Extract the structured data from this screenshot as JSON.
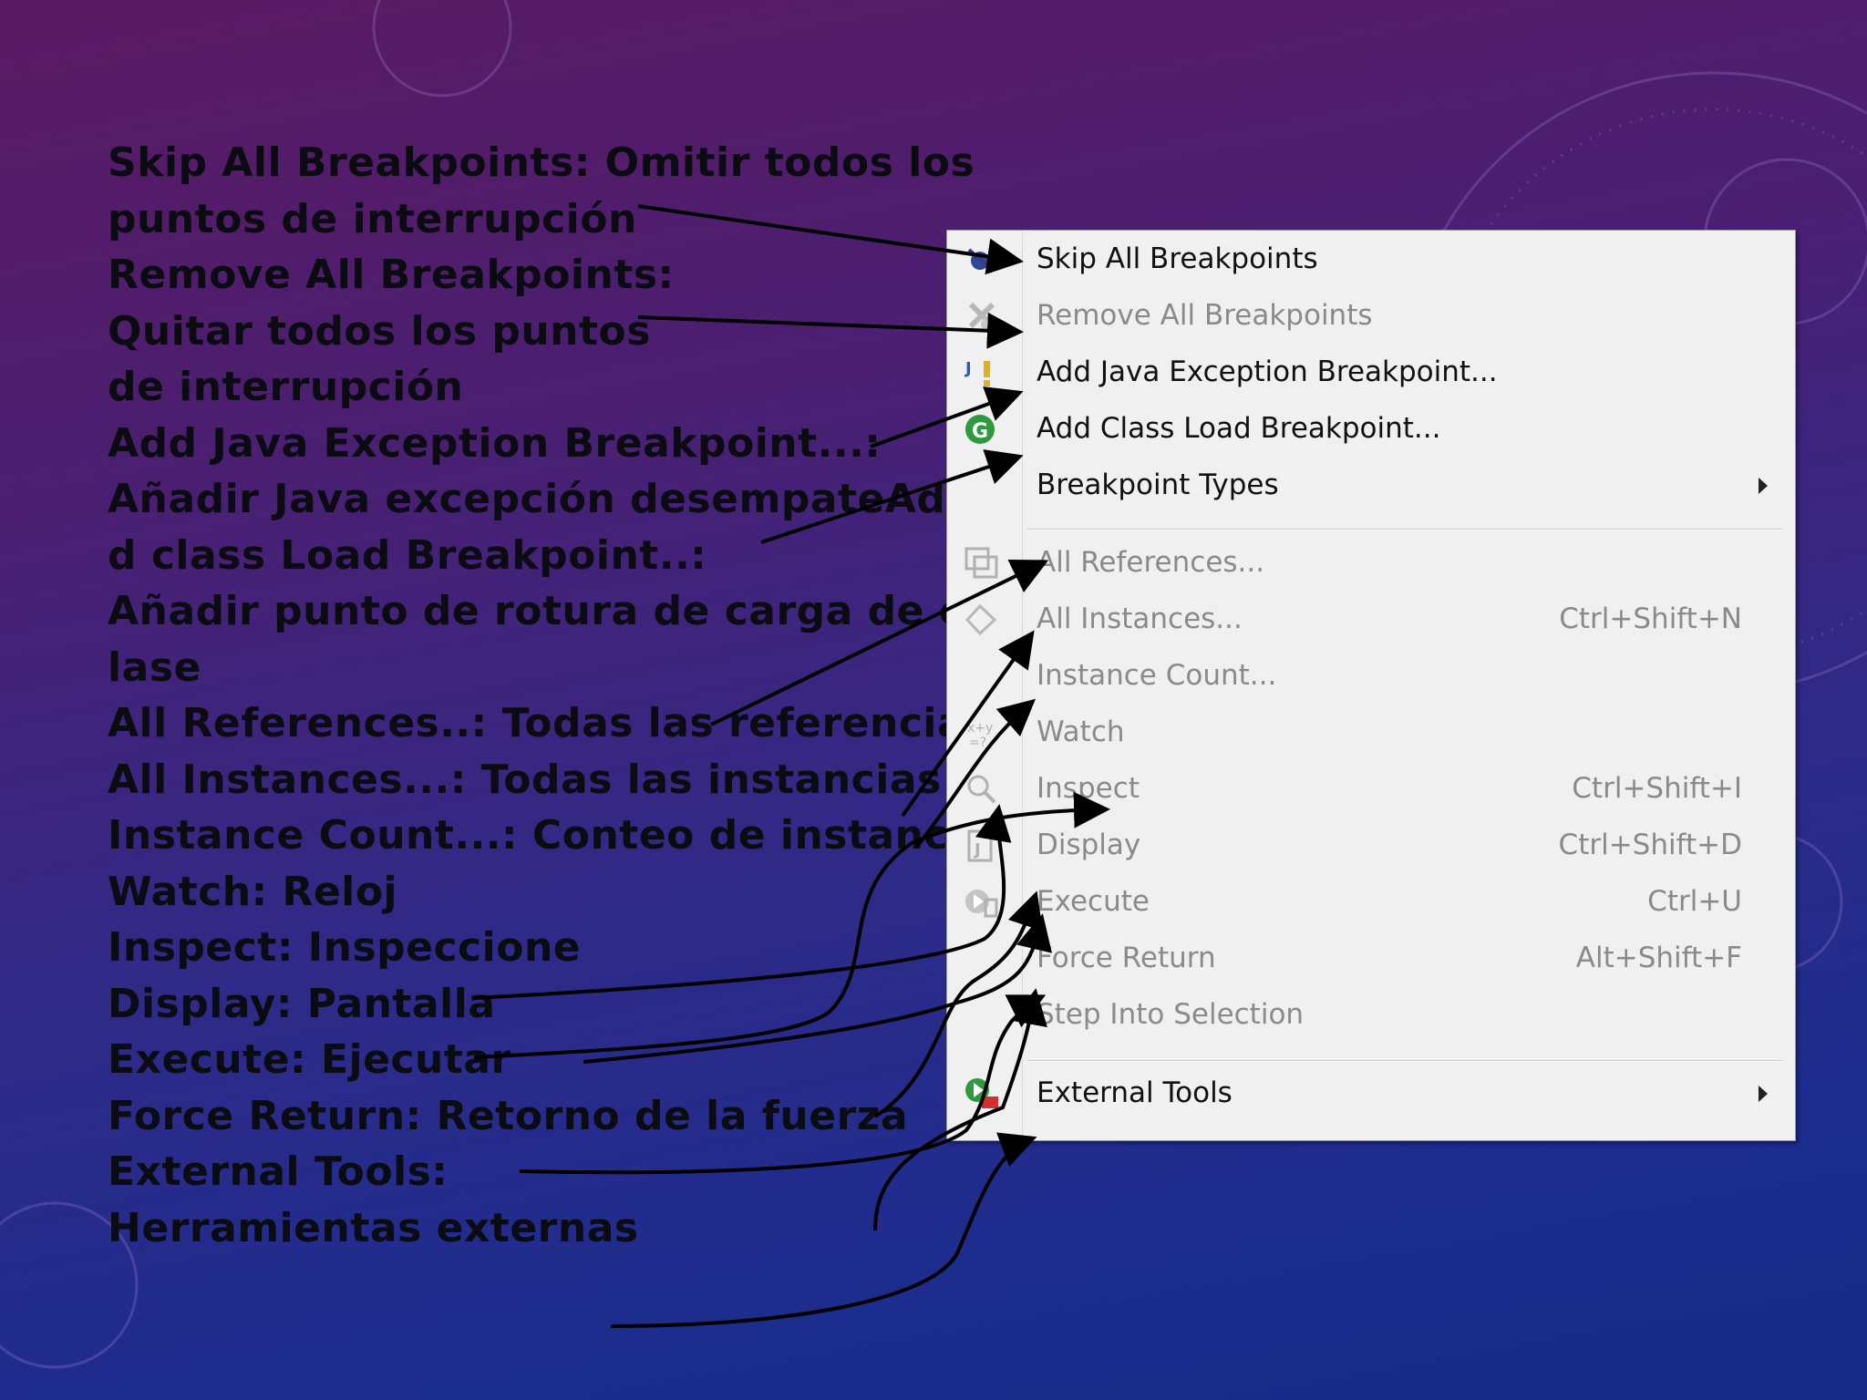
{
  "annotation_lines": [
    "Skip All Breakpoints: Omitir todos los",
    "puntos de interrupción",
    "Remove All Breakpoints:",
    "Quitar todos los puntos",
    "de interrupción",
    "Add Java Exception Breakpoint...:",
    "Añadir Java excepción desempateAd",
    "d class Load Breakpoint..:",
    "Añadir punto de rotura de carga de c",
    "lase",
    "All References..: Todas las referencias",
    "All Instances...: Todas las instancias",
    "Instance Count...: Conteo de instancia",
    "Watch: Reloj",
    "Inspect: Inspeccione",
    "Display: Pantalla",
    "Execute: Ejecutar",
    "Force Return: Retorno de la fuerza",
    "External Tools:",
    "Herramientas externas"
  ],
  "menu": {
    "items": [
      {
        "label": "Skip All Breakpoints",
        "shortcut": "",
        "icon": "skip-breakpoints-icon",
        "enabled": true
      },
      {
        "label": "Remove All Breakpoints",
        "shortcut": "",
        "icon": "remove-breakpoints-icon",
        "enabled": false
      },
      {
        "label": "Add Java Exception Breakpoint...",
        "shortcut": "",
        "icon": "java-exception-breakpoint-icon",
        "enabled": true
      },
      {
        "label": "Add Class Load Breakpoint...",
        "shortcut": "",
        "icon": "class-load-breakpoint-icon",
        "enabled": true
      },
      {
        "label": "Breakpoint Types",
        "shortcut": "",
        "icon": "",
        "enabled": true,
        "submenu": true
      },
      {
        "label": "All References...",
        "shortcut": "",
        "icon": "all-references-icon",
        "enabled": false
      },
      {
        "label": "All Instances...",
        "shortcut": "Ctrl+Shift+N",
        "icon": "all-instances-icon",
        "enabled": false
      },
      {
        "label": "Instance Count...",
        "shortcut": "",
        "icon": "",
        "enabled": false
      },
      {
        "label": "Watch",
        "shortcut": "",
        "icon": "watch-icon",
        "enabled": false
      },
      {
        "label": "Inspect",
        "shortcut": "Ctrl+Shift+I",
        "icon": "inspect-icon",
        "enabled": false
      },
      {
        "label": "Display",
        "shortcut": "Ctrl+Shift+D",
        "icon": "display-icon",
        "enabled": false
      },
      {
        "label": "Execute",
        "shortcut": "Ctrl+U",
        "icon": "execute-icon",
        "enabled": false
      },
      {
        "label": "Force Return",
        "shortcut": "Alt+Shift+F",
        "icon": "",
        "enabled": false
      },
      {
        "label": "Step Into Selection",
        "shortcut": "",
        "icon": "",
        "enabled": false
      },
      {
        "label": "External Tools",
        "shortcut": "",
        "icon": "external-tools-icon",
        "enabled": true,
        "submenu": true
      }
    ]
  },
  "colors": {
    "background_top": "#5a1a62",
    "background_bottom": "#172a86",
    "annotation_text": "#0b0b12",
    "menu_background": "#f0f0f0",
    "disabled_text": "#8a8a8a"
  }
}
